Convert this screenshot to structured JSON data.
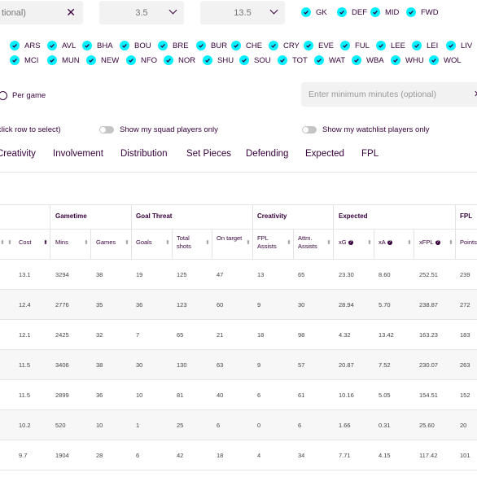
{
  "filters": {
    "search_text": "tional)",
    "min_value": "3.5",
    "max_value": "13.5",
    "positions": [
      "GK",
      "DEF",
      "MID",
      "FWD"
    ],
    "teams_row1": [
      "ARS",
      "AVL",
      "BHA",
      "BOU",
      "BRE",
      "BUR",
      "CHE",
      "CRY",
      "EVE",
      "FUL",
      "LEE",
      "LEI",
      "LIV"
    ],
    "teams_row2": [
      "MCI",
      "MUN",
      "NEW",
      "NFO",
      "NOR",
      "SHU",
      "SOU",
      "TOT",
      "WAT",
      "WBA",
      "WHU",
      "WOL"
    ],
    "per_game_label": "Per game",
    "min_minutes_placeholder": "Enter minimum minutes (optional)",
    "click_hint": "click row to select)",
    "squad_toggle_label": "Show my squad players only",
    "watchlist_toggle_label": "Show my watchlist players only"
  },
  "tabs": [
    "Creativity",
    "Involvement",
    "Distribution",
    "Set Pieces",
    "Defending",
    "Expected",
    "FPL"
  ],
  "table": {
    "groups": [
      "Gametime",
      "Goal Threat",
      "Creativity",
      "Expected",
      "FPL"
    ],
    "columns": [
      "Cost",
      "Mins",
      "Games",
      "Goals",
      "Total shots",
      "On target",
      "FPL Assists",
      "Attm. Assists",
      "xG",
      "xA",
      "xFPL",
      "Points"
    ],
    "rows": [
      [
        "13.1",
        "3294",
        "38",
        "19",
        "125",
        "47",
        "13",
        "65",
        "23.30",
        "8.60",
        "252.51",
        "239"
      ],
      [
        "12.4",
        "2776",
        "35",
        "36",
        "123",
        "60",
        "9",
        "30",
        "28.94",
        "5.70",
        "238.87",
        "272"
      ],
      [
        "12.1",
        "2425",
        "32",
        "7",
        "65",
        "21",
        "18",
        "98",
        "4.32",
        "13.42",
        "163.23",
        "183"
      ],
      [
        "11.5",
        "3406",
        "38",
        "30",
        "130",
        "63",
        "9",
        "57",
        "20.87",
        "7.52",
        "230.07",
        "263"
      ],
      [
        "11.5",
        "2899",
        "36",
        "10",
        "81",
        "40",
        "6",
        "61",
        "10.16",
        "5.05",
        "154.51",
        "152"
      ],
      [
        "10.2",
        "520",
        "10",
        "1",
        "25",
        "6",
        "0",
        "6",
        "1.66",
        "0.31",
        "25.60",
        "20"
      ],
      [
        "9.7",
        "1904",
        "28",
        "6",
        "42",
        "18",
        "4",
        "34",
        "7.71",
        "4.15",
        "117.42",
        "101"
      ]
    ]
  }
}
